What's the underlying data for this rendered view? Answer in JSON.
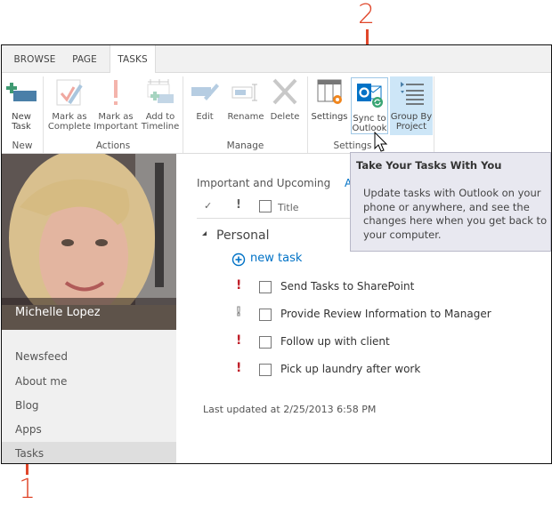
{
  "callouts": {
    "one": "1",
    "two": "2"
  },
  "tabs": [
    {
      "label": "BROWSE",
      "active": false
    },
    {
      "label": "PAGE",
      "active": false
    },
    {
      "label": "TASKS",
      "active": true
    }
  ],
  "ribbon": {
    "groups": {
      "new": "New",
      "actions": "Actions",
      "manage": "Manage",
      "settings": "Settings"
    },
    "buttons": {
      "new_task": "New Task",
      "mark_complete": "Mark as Complete",
      "mark_important": "Mark as Important",
      "add_timeline": "Add to Timeline",
      "edit": "Edit",
      "rename": "Rename",
      "delete": "Delete",
      "settings": "Settings",
      "sync_outlook": "Sync to Outlook",
      "group_by_project": "Group By Project"
    }
  },
  "sidebar": {
    "user_name": "Michelle Lopez",
    "items": [
      {
        "label": "Newsfeed",
        "active": false
      },
      {
        "label": "About me",
        "active": false
      },
      {
        "label": "Blog",
        "active": false
      },
      {
        "label": "Apps",
        "active": false
      },
      {
        "label": "Tasks",
        "active": true
      }
    ]
  },
  "main": {
    "view_tabs": [
      "Important and Upcoming",
      "A"
    ],
    "columns": {
      "check": "✓",
      "important": "!",
      "title": "Title"
    },
    "group_name": "Personal",
    "new_task_label": "new task",
    "tasks": [
      {
        "title": "Send Tasks to SharePoint",
        "important": true
      },
      {
        "title": "Provide Review Information to Manager",
        "important": false
      },
      {
        "title": "Follow up with client",
        "important": true
      },
      {
        "title": "Pick up laundry after work",
        "important": true
      }
    ],
    "last_updated": "Last updated at 2/25/2013 6:58 PM"
  },
  "tooltip": {
    "title": "Take Your Tasks With You",
    "body": "Update tasks with Outlook on your phone or anywhere, and see the changes here when you get back to your computer."
  },
  "colors": {
    "accent": "#0072c6",
    "important": "#c0202a",
    "callout": "#e0462a",
    "selected": "#cde6f7"
  }
}
